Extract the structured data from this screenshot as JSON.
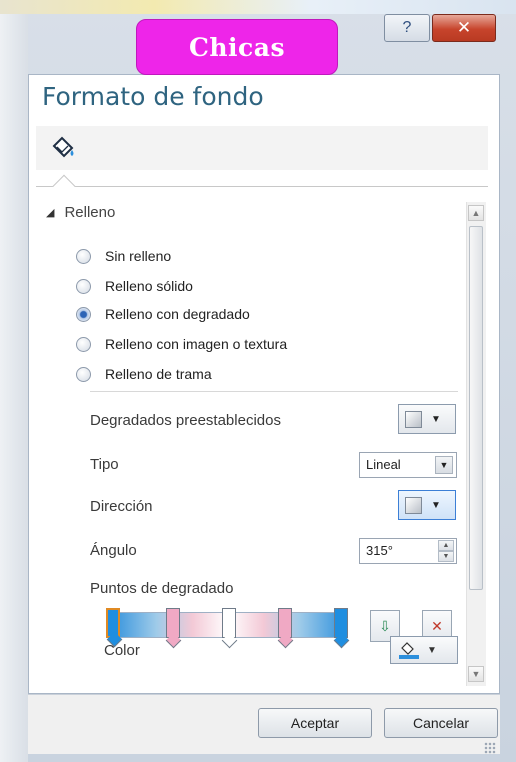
{
  "window": {
    "help_label": "?",
    "close_label": "✕"
  },
  "overlay": {
    "text": "Chicas"
  },
  "pane": {
    "title": "Formato de fondo",
    "icon": "paint-bucket-icon"
  },
  "fill_section": {
    "header": "Relleno",
    "options": [
      {
        "label": "Sin relleno",
        "selected": false
      },
      {
        "label": "Relleno sólido",
        "selected": false
      },
      {
        "label": "Relleno con degradado",
        "selected": true
      },
      {
        "label": "Relleno con imagen o textura",
        "selected": false
      },
      {
        "label": "Relleno de trama",
        "selected": false
      }
    ]
  },
  "gradient": {
    "preset_label": "Degradados preestablecidos",
    "type_label": "Tipo",
    "type_value": "Lineal",
    "direction_label": "Dirección",
    "angle_label": "Ángulo",
    "angle_value": "315°",
    "stops_label": "Puntos de degradado",
    "stops": [
      {
        "color": "#1f8ee0",
        "selected": true
      },
      {
        "color": "#f0a9c4",
        "selected": false
      },
      {
        "color": "#ffffff",
        "selected": false
      },
      {
        "color": "#f0a9c4",
        "selected": false
      },
      {
        "color": "#1f8ee0",
        "selected": false
      }
    ],
    "color_label": "Color",
    "accent_color": "#2c8fdc"
  },
  "dialog": {
    "ok_label": "Aceptar",
    "cancel_label": "Cancelar"
  }
}
